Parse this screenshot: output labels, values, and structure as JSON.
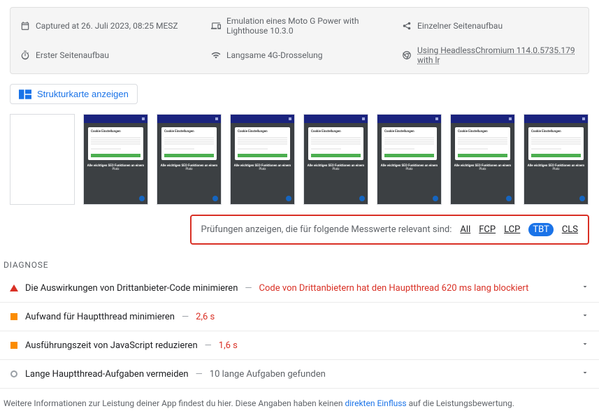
{
  "meta": {
    "captured_at": "Captured at 26. Juli 2023, 08:25 MESZ",
    "emulation": "Emulation eines Moto G Power with Lighthouse 10.3.0",
    "single_page": "Einzelner Seitenaufbau",
    "first_load": "Erster Seitenaufbau",
    "throttling": "Langsame 4G-Drosselung",
    "ua": "Using HeadlessChromium 114.0.5735.179 with lr"
  },
  "treemap_button": "Strukturkarte anzeigen",
  "filmstrip": {
    "card_title": "Cookie Einstellungen",
    "banner_bold": "Alle wichtigen SEO Funktionen an einem",
    "banner_sub": "Platz"
  },
  "filter": {
    "label": "Prüfungen anzeigen, die für folgende Messwerte relevant sind:",
    "all": "All",
    "fcp": "FCP",
    "lcp": "LCP",
    "tbt": "TBT",
    "cls": "CLS",
    "active": "TBT"
  },
  "section": "DIAGNOSE",
  "audits": [
    {
      "shape": "tri",
      "title": "Die Auswirkungen von Drittanbieter-Code minimieren",
      "detail": "Code von Drittanbietern hat den Hauptthread 620 ms lang blockiert",
      "detail_style": "red"
    },
    {
      "shape": "sq",
      "title": "Aufwand für Hauptthread minimieren",
      "detail": "2,6 s",
      "detail_style": "red"
    },
    {
      "shape": "sq",
      "title": "Ausführungszeit von JavaScript reduzieren",
      "detail": "1,6 s",
      "detail_style": "red"
    },
    {
      "shape": "circ",
      "title": "Lange Hauptthread-Aufgaben vermeiden",
      "detail": "10 lange Aufgaben gefunden",
      "detail_style": "gray"
    }
  ],
  "footer": {
    "before": "Weitere Informationen zur Leistung deiner App findest du hier. Diese Angaben haben keinen ",
    "link": "direkten Einfluss",
    "after": " auf die Leistungsbewertung."
  }
}
